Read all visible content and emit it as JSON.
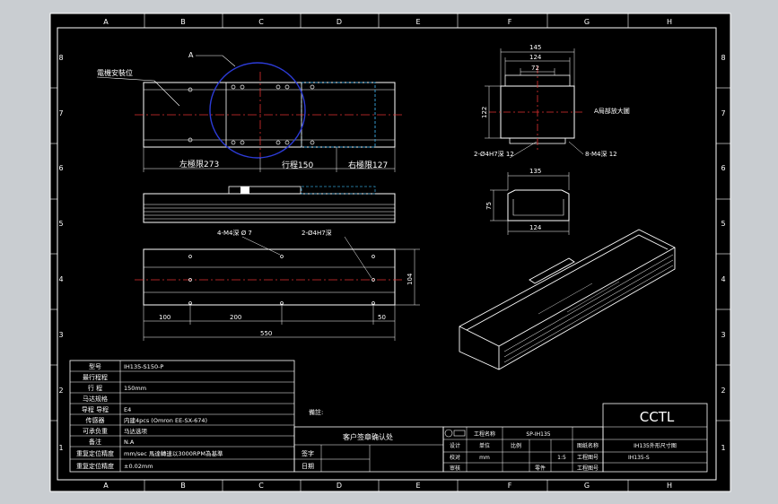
{
  "border": {
    "cols": [
      "A",
      "B",
      "C",
      "D",
      "E",
      "F",
      "G",
      "H"
    ],
    "rows": [
      "8",
      "7",
      "6",
      "5",
      "4",
      "3",
      "2",
      "1"
    ]
  },
  "top_view": {
    "mount_label": "電機安裝位",
    "detail_label": "A",
    "dim_left": "左極限273",
    "dim_stroke": "行程150",
    "dim_right": "右極限127"
  },
  "bottom_view": {
    "hole_note_1": "4-M4深 Ø 7",
    "hole_note_2": "2-Ø4H7深",
    "dim_height": "104",
    "dim_100": "100",
    "dim_200": "200",
    "dim_50": "50",
    "dim_550": "550"
  },
  "end_view": {
    "dim_145": "145",
    "dim_124": "124",
    "dim_72": "72",
    "dim_122": "122",
    "note_a": "A局部放大圖",
    "note_pin": "2-Ø4H7深 12",
    "note_screw": "8-M4深 12"
  },
  "section_view": {
    "dim_135": "135",
    "dim_75": "75",
    "dim_124": "124"
  },
  "spec_table": {
    "rows": [
      {
        "label": "型号",
        "value": "IH135-S150-P"
      },
      {
        "label": "最行程程",
        "value": ""
      },
      {
        "label": "行 程",
        "value": "150mm"
      },
      {
        "label": "马达规格",
        "value": ""
      },
      {
        "label": "导程 导程",
        "value": "E4"
      },
      {
        "label": "传感器",
        "value": "内建4pcs (Omron EE-SX-674)"
      },
      {
        "label": "可承负重",
        "value": "马达选项"
      },
      {
        "label": "备注",
        "value": "N.A"
      },
      {
        "label": "重复定位精度",
        "value": "±0.02mm"
      },
      {
        "label": "重复定位精度",
        "value": "±0.02mm"
      }
    ],
    "long_note": "mm/sec 馬達轉速以3000RPM為基準"
  },
  "title_block": {
    "note_label": "備註:",
    "confirm_title": "客户签章确认处",
    "sign_label": "签字",
    "date_label": "日期",
    "project_label": "工程名称",
    "project_value": "SP-IH135",
    "drawn_label": "设计",
    "check_label": "校对",
    "approve_label": "审核",
    "scale_label": "比例",
    "unit_label": "单位",
    "unit_value": "mm",
    "scale_value": "1:5",
    "drawing_label": "图纸名称",
    "drawing_no_label": "工程图号",
    "drawing_no_label_2": "工程图号",
    "part_label": "零件",
    "company": "CCTL",
    "drawing_name": "IH135外形尺寸图",
    "drawing_no": "IH135-S"
  }
}
